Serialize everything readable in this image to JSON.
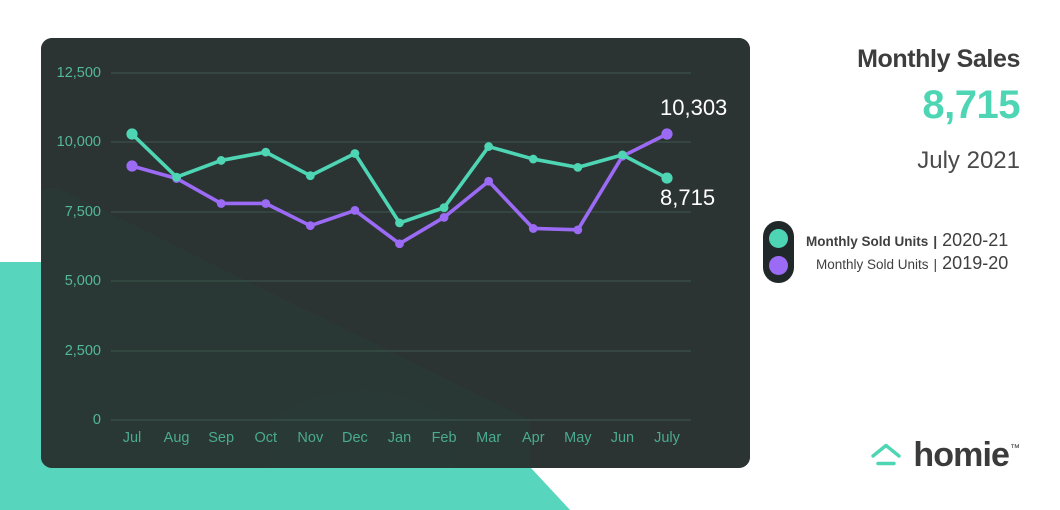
{
  "kpi": {
    "title": "Monthly Sales",
    "value": "8,715",
    "period": "July 2021",
    "value_color": "#4ed6b4"
  },
  "legend": {
    "primary": {
      "name": "Monthly Sold Units",
      "separator": "|",
      "period": "2020-21",
      "color": "#4ed6b4"
    },
    "secondary": {
      "name": "Monthly Sold Units",
      "separator": "|",
      "period": "2019-20",
      "color": "#9b6bf5"
    }
  },
  "brand": {
    "wordmark": "homie",
    "trademark": "™",
    "mark_icon": "house-roof-icon",
    "mark_color": "#4ed6b4"
  },
  "end_labels": {
    "upper": "10,303",
    "lower": "8,715"
  },
  "chart_data": {
    "type": "line",
    "title": "Monthly Sales",
    "xlabel": "",
    "ylabel": "",
    "ylim": [
      0,
      13500
    ],
    "yticks": [
      0,
      2500,
      5000,
      7500,
      10000,
      12500
    ],
    "ytick_labels": [
      "0",
      "2,500",
      "5,000",
      "7,500",
      "10,000",
      "12,500"
    ],
    "grid": true,
    "legend_position": "right",
    "categories": [
      "Jul",
      "Aug",
      "Sep",
      "Oct",
      "Nov",
      "Dec",
      "Jan",
      "Feb",
      "Mar",
      "Apr",
      "May",
      "Jun",
      "July"
    ],
    "series": [
      {
        "name": "Monthly Sold Units 2020-21",
        "color": "#4ed6b4",
        "end_label": "8,715",
        "values": [
          10303,
          8750,
          9350,
          9650,
          8800,
          9600,
          7100,
          7650,
          9850,
          9400,
          9100,
          9550,
          8715
        ]
      },
      {
        "name": "Monthly Sold Units 2019-20",
        "color": "#9b6bf5",
        "end_label": "10,303",
        "values": [
          9150,
          8700,
          7800,
          7800,
          7000,
          7550,
          6350,
          7300,
          8600,
          6900,
          6850,
          9500,
          10303
        ]
      }
    ]
  },
  "theme": {
    "panel_bg": "#2c3333",
    "page_bg": "#ffffff",
    "decor_color": "#58d6bd",
    "gridline_color": "#3d5750",
    "ytick_color": "#54b89a",
    "xtick_color": "#4aab90",
    "end_label_color": "#ffffff"
  }
}
